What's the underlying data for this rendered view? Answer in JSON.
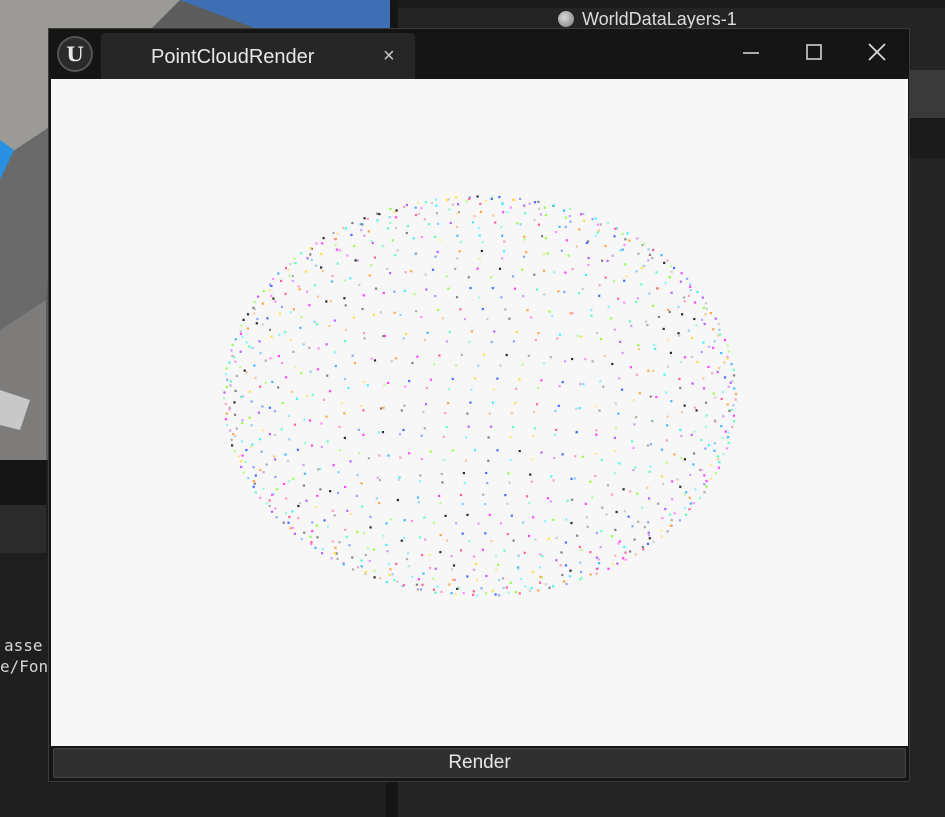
{
  "background": {
    "outliner_item_label": "WorldDataLayers-1",
    "log_lines": [
      "asse",
      "e/Fon"
    ]
  },
  "window": {
    "app_icon": "unreal-engine-logo",
    "app_icon_glyph": "U",
    "tab_title": "PointCloudRender",
    "tab_close_glyph": "×",
    "controls": [
      "minimize-icon",
      "maximize-icon",
      "close-icon"
    ],
    "render_button_label": "Render"
  },
  "point_cloud": {
    "shape": "sphere",
    "palette": [
      "#ff3cff",
      "#3cf0ff",
      "#8cff3c",
      "#ffdc3c",
      "#3c64ff",
      "#ff5a96",
      "#5affb4",
      "#b45aff",
      "#aaaaaa",
      "#ffa03c",
      "#222222",
      "#3cb4ff"
    ]
  },
  "colors": {
    "window_bg": "#151515",
    "tab_bg": "#262626",
    "canvas_bg": "#f7f7f7",
    "button_bg": "#303030"
  }
}
